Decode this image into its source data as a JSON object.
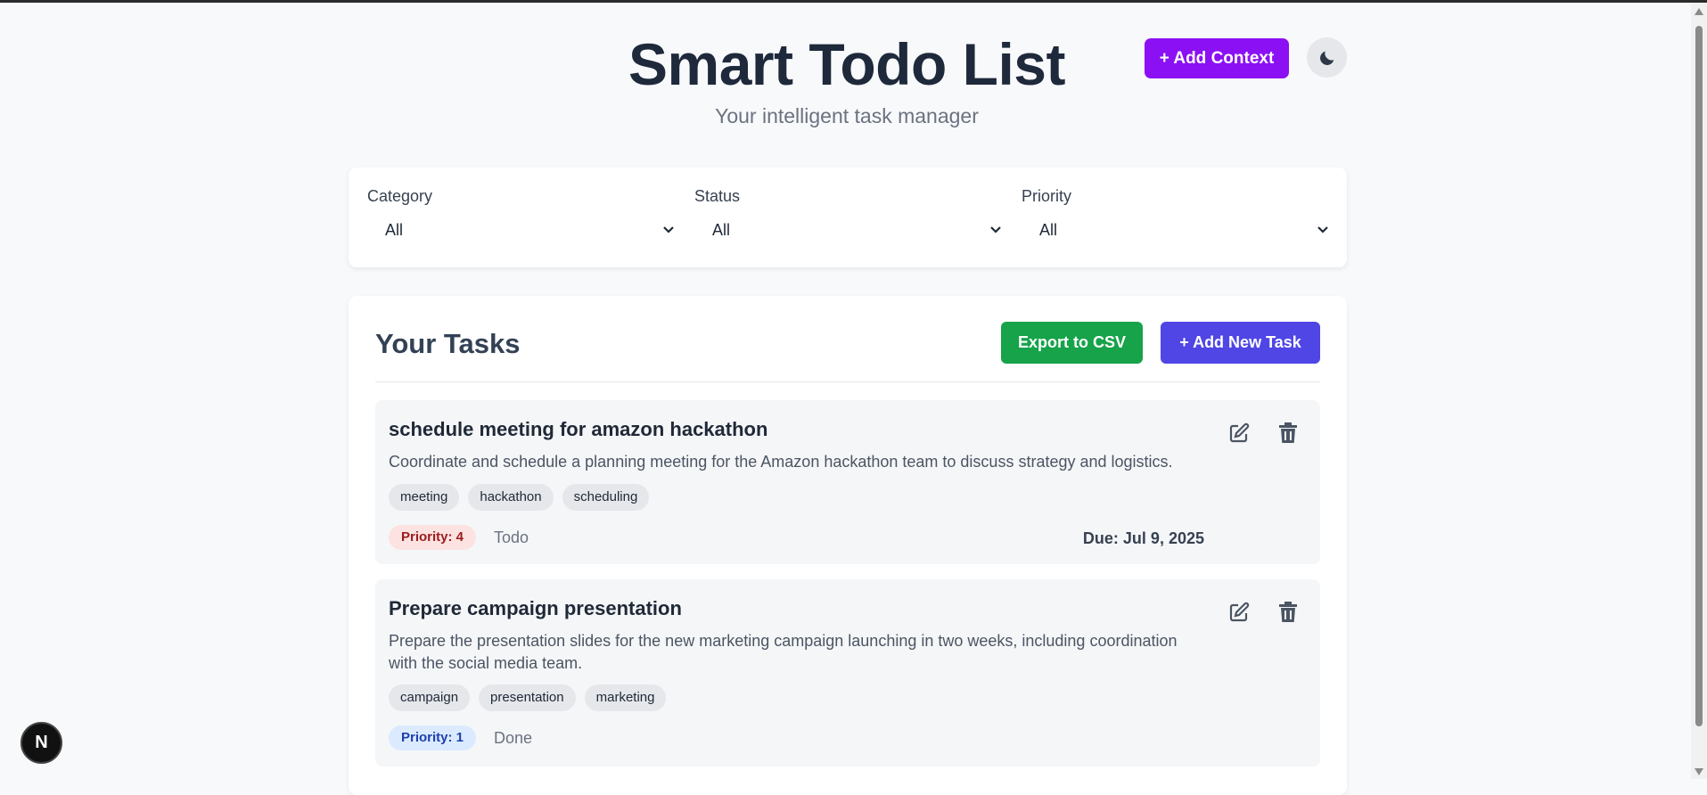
{
  "header": {
    "title": "Smart Todo List",
    "subtitle": "Your intelligent task manager",
    "add_context_label": "+ Add Context",
    "theme_icon": "moon-icon"
  },
  "filters": [
    {
      "label": "Category",
      "value": "All"
    },
    {
      "label": "Status",
      "value": "All"
    },
    {
      "label": "Priority",
      "value": "All"
    }
  ],
  "tasks_panel": {
    "title": "Your Tasks",
    "export_label": "Export to CSV",
    "add_task_label": "+ Add New Task",
    "tasks": [
      {
        "title": "schedule meeting for amazon hackathon",
        "description": "Coordinate and schedule a planning meeting for the Amazon hackathon team to discuss strategy and logistics.",
        "tags": [
          "meeting",
          "hackathon",
          "scheduling"
        ],
        "priority": "Priority: 4",
        "status": "Todo",
        "due": "Due: Jul 9, 2025"
      },
      {
        "title": "Prepare campaign presentation",
        "description": "Prepare the presentation slides for the new marketing campaign launching in two weeks, including coordination with the social media team.",
        "tags": [
          "campaign",
          "presentation",
          "marketing"
        ],
        "priority": "Priority: 1",
        "status": "Done",
        "due": ""
      }
    ]
  },
  "badge": {
    "letter": "N"
  },
  "colors": {
    "context_button": "#8b10f3",
    "export_button": "#16a34a",
    "add_task_button": "#4f46e5",
    "priority_high_bg": "#fde2e2",
    "priority_low_bg": "#dbeafe"
  }
}
